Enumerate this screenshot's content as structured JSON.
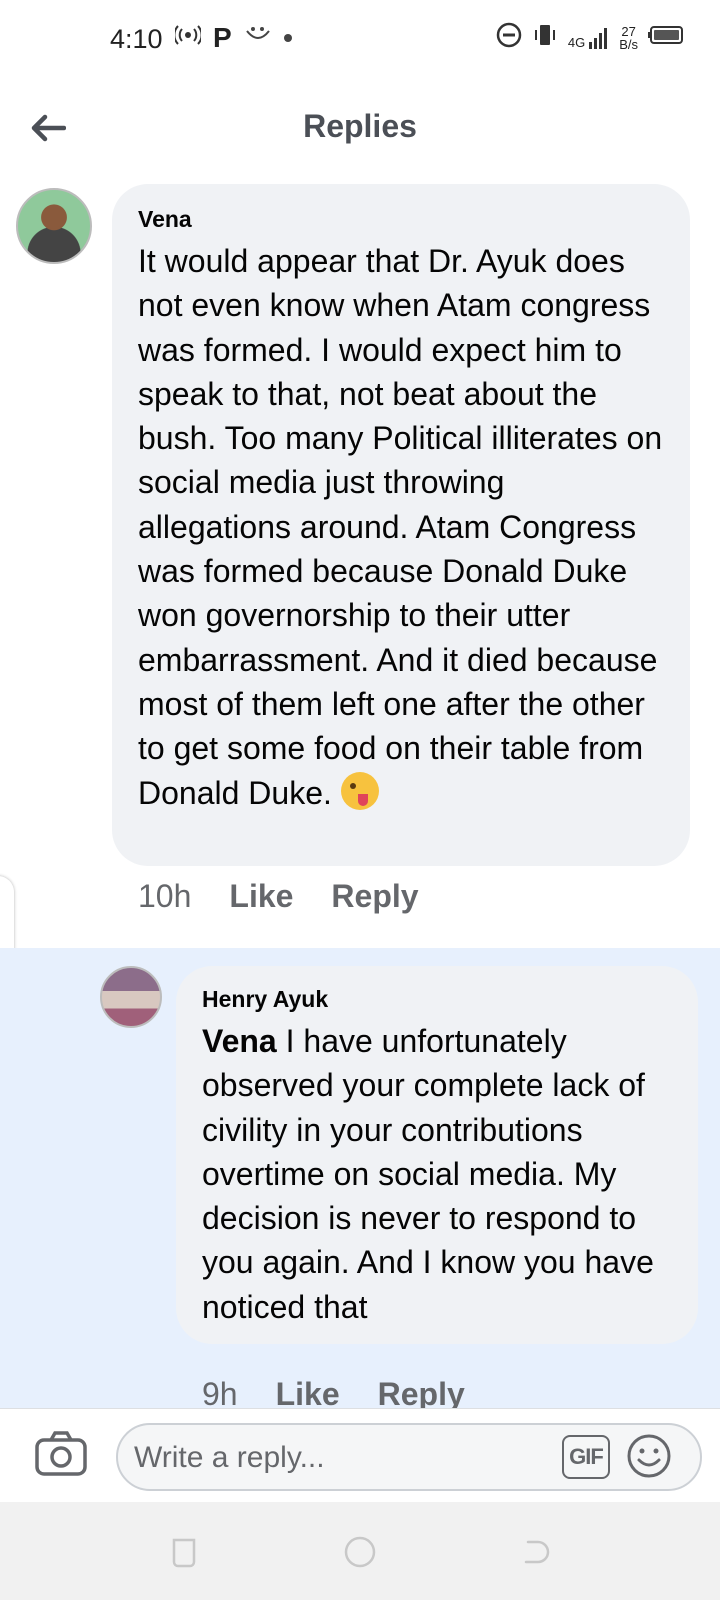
{
  "status_bar": {
    "time": "4:10",
    "network_type": "4G",
    "speed_value": "27",
    "speed_unit": "B/s",
    "carrier_badge": "P"
  },
  "header": {
    "title": "Replies"
  },
  "comments": [
    {
      "author": "Vena",
      "text": "It would appear that Dr. Ayuk does not even know when Atam congress was formed. I would expect him to speak to that, not beat about the bush. Too many Political illiterates on social media just throwing allegations around. Atam Congress was formed because Donald Duke won governorship to their utter embarrassment. And it died because most of them left one after the other to get some food on their table from Donald Duke.",
      "time": "10h",
      "like_label": "Like",
      "reply_label": "Reply"
    },
    {
      "author": "Henry Ayuk",
      "mention": "Vena",
      "text": " I have unfortunately observed your complete lack of civility in your contributions overtime on social media. My decision is never to respond to you again. And I know you have noticed that",
      "time": "9h",
      "like_label": "Like",
      "reply_label": "Reply",
      "highlighted": true
    }
  ],
  "composer": {
    "placeholder": "Write a reply...",
    "gif_label": "GIF"
  },
  "colors": {
    "bubble": "#f0f2f5",
    "highlight": "#e7f0fd",
    "meta_text": "#65676b",
    "title_text": "#4b4f56"
  }
}
